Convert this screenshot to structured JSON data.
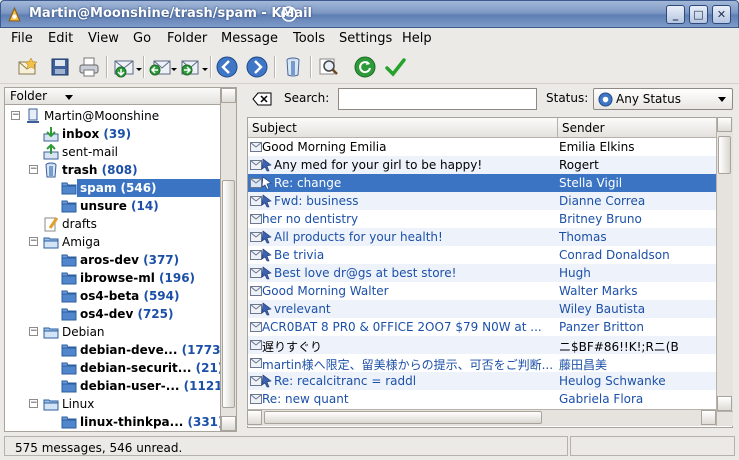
{
  "window": {
    "title": "Martin@Moonshine/trash/spam - KMail"
  },
  "menubar": [
    "File",
    "Edit",
    "View",
    "Go",
    "Folder",
    "Message",
    "Tools",
    "Settings",
    "Help"
  ],
  "toolbar": [
    "new-message-icon",
    "save-icon",
    "print-icon",
    "check-mail-icon",
    "reply-icon",
    "forward-icon",
    "previous-icon",
    "next-icon",
    "trash-icon",
    "find-icon",
    "refresh-icon",
    "mark-icon"
  ],
  "folder_pane": {
    "header": "Folder",
    "items": [
      {
        "label": "Martin@Moonshine",
        "count": "",
        "level": 0,
        "icon": "account-icon",
        "bold": false
      },
      {
        "label": "inbox",
        "count": "(39)",
        "level": 1,
        "icon": "inbox-icon",
        "bold": true
      },
      {
        "label": "sent-mail",
        "count": "",
        "level": 1,
        "icon": "sent-mail-icon",
        "bold": false
      },
      {
        "label": "trash",
        "count": "(808)",
        "level": 1,
        "icon": "trash-folder-icon",
        "bold": true
      },
      {
        "label": "spam",
        "count": "(546)",
        "level": 2,
        "icon": "folder-icon",
        "bold": true,
        "selected": true
      },
      {
        "label": "unsure",
        "count": "(14)",
        "level": 2,
        "icon": "folder-icon",
        "bold": true
      },
      {
        "label": "drafts",
        "count": "",
        "level": 1,
        "icon": "drafts-icon",
        "bold": false
      },
      {
        "label": "Amiga",
        "count": "",
        "level": 1,
        "icon": "folder-open-icon",
        "bold": false
      },
      {
        "label": "aros-dev",
        "count": "(377)",
        "level": 2,
        "icon": "folder-icon",
        "bold": true
      },
      {
        "label": "ibrowse-ml",
        "count": "(196)",
        "level": 2,
        "icon": "folder-icon",
        "bold": true
      },
      {
        "label": "os4-beta",
        "count": "(594)",
        "level": 2,
        "icon": "folder-icon",
        "bold": true
      },
      {
        "label": "os4-dev",
        "count": "(725)",
        "level": 2,
        "icon": "folder-icon",
        "bold": true
      },
      {
        "label": "Debian",
        "count": "",
        "level": 1,
        "icon": "folder-open-icon",
        "bold": false
      },
      {
        "label": "debian-deve...",
        "count": "(1773)",
        "level": 2,
        "icon": "folder-icon",
        "bold": true
      },
      {
        "label": "debian-securit...",
        "count": "(21)",
        "level": 2,
        "icon": "folder-icon",
        "bold": true
      },
      {
        "label": "debian-user-...",
        "count": "(1121)",
        "level": 2,
        "icon": "folder-icon",
        "bold": true
      },
      {
        "label": "Linux",
        "count": "",
        "level": 1,
        "icon": "folder-open-icon",
        "bold": false
      },
      {
        "label": "linux-thinkpa...",
        "count": "(331)",
        "level": 2,
        "icon": "folder-icon",
        "bold": true
      }
    ]
  },
  "search": {
    "label": "Search:",
    "value": "",
    "status_label": "Status:",
    "status_value": "Any Status"
  },
  "message_list": {
    "columns": [
      "Subject",
      "Sender"
    ],
    "rows": [
      {
        "subject": "Good Morning Emilia",
        "sender": "Emilia Elkins",
        "unread": false,
        "spam": false
      },
      {
        "subject": "Any med for your girl to be happy!",
        "sender": "Rogert",
        "unread": false,
        "spam": true
      },
      {
        "subject": "Re: change",
        "sender": "Stella Vigil",
        "unread": true,
        "spam": true,
        "selected": true
      },
      {
        "subject": "Fwd: business",
        "sender": "Dianne Correa",
        "unread": true,
        "spam": true
      },
      {
        "subject": "her no dentistry",
        "sender": "Britney Bruno",
        "unread": true,
        "spam": false
      },
      {
        "subject": "All products for your health!",
        "sender": "Thomas",
        "unread": true,
        "spam": true
      },
      {
        "subject": "Be trivia",
        "sender": "Conrad Donaldson",
        "unread": true,
        "spam": true
      },
      {
        "subject": "Best love dr@gs at best store!",
        "sender": "Hugh",
        "unread": true,
        "spam": true
      },
      {
        "subject": "Good Morning Walter",
        "sender": "Walter Marks",
        "unread": true,
        "spam": false
      },
      {
        "subject": "vrelevant",
        "sender": "Wiley Bautista",
        "unread": true,
        "spam": true
      },
      {
        "subject": "ACR0BAT 8 PR0 & 0FFICE 2OO7 $79 N0W at ...",
        "sender": "Panzer Britton",
        "unread": true,
        "spam": false
      },
      {
        "subject": "遅りすぐり",
        "sender": "ニ$BF#86!!K!;Rニ(B",
        "unread": false,
        "spam": false
      },
      {
        "subject": "martin様へ限定、留美様からの提示、可否をご判断...",
        "sender": "藤田昌美",
        "unread": true,
        "spam": false
      },
      {
        "subject": "Re: recalcitranc =  raddl",
        "sender": "Heulog Schwanke",
        "unread": true,
        "spam": true
      },
      {
        "subject": "Re: new quant",
        "sender": "Gabriela Flora",
        "unread": true,
        "spam": false
      }
    ]
  },
  "statusbar": {
    "text": "575 messages, 546 unread."
  },
  "colors": {
    "selection": "#3a74c3",
    "unread_text": "#1c50a8",
    "alt_row": "#eef3fb"
  }
}
